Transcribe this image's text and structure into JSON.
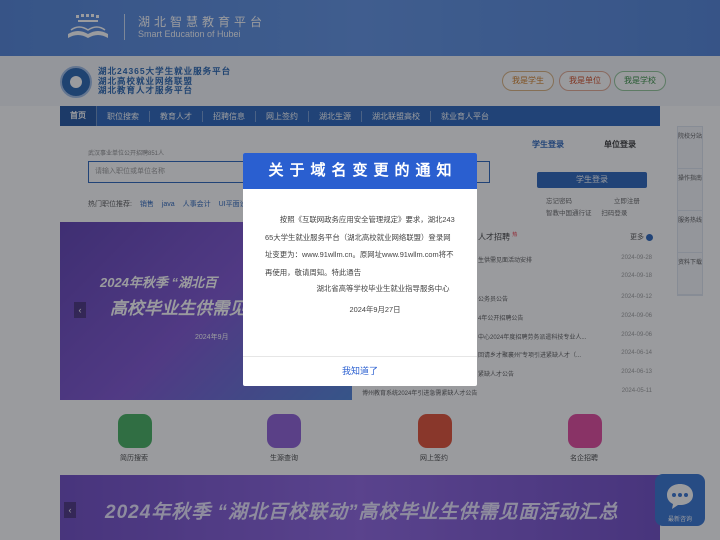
{
  "topbar": {
    "title_cn": "湖北智慧教育平台",
    "title_en": "Smart Education of Hubei"
  },
  "brand": {
    "line1": "湖北24365大学生就业服务平台",
    "line2": "湖北高校就业网络联盟",
    "line3": "湖北教育人才服务平台"
  },
  "role_buttons": [
    "我是学生",
    "我是单位",
    "我是学校"
  ],
  "nav": {
    "items": [
      "首页",
      "职位搜索",
      "教育人才",
      "招聘信息",
      "网上签约",
      "湖北生源",
      "湖北联盟高校",
      "就业育人平台"
    ]
  },
  "search": {
    "hint": "武汉事业单位公开招聘851人",
    "placeholder": "请输入职位或单位名称",
    "hot_label": "热门职位推荐:",
    "hot_items": [
      "销售",
      "java",
      "人事会计",
      "UI平面设计"
    ]
  },
  "login": {
    "tab_student": "学生登录",
    "tab_company": "单位登录",
    "button": "学生登录",
    "forgot": "忘记密码",
    "register": "立即注册",
    "alt1": "智教中国通行证",
    "alt2": "扫码登录"
  },
  "side_float": [
    "院校分站",
    "操作指南",
    "服务热线",
    "资料下载"
  ],
  "banner": {
    "line1": "2024年秋季 “湖北百",
    "line2": "高校毕业生供需见面",
    "line3": "2024年9月"
  },
  "news": {
    "header": "人才招聘",
    "badge": "热",
    "more": "更多",
    "rows": [
      {
        "text": "生供需见面活动安排",
        "date": "2024-09-28"
      },
      {
        "text": "",
        "date": "2024-09-18"
      },
      {
        "text": "公务员公告",
        "date": "2024-09-12"
      },
      {
        "text": "4年公开招聘公告",
        "date": "2024-09-06"
      },
      {
        "text": "中心2024年度招聘劳务派遣科技专业人...",
        "date": "2024-09-06"
      },
      {
        "text": "回请乡才聚襄州”专项引进紧缺人才（...",
        "date": "2024-06-14"
      },
      {
        "text": "紧缺人才公告",
        "date": "2024-06-13"
      },
      {
        "text": "博州教育系统2024年引进急需紧缺人才公告",
        "date": "2024-05-11"
      }
    ]
  },
  "quick_links": [
    "简历搜索",
    "生源查询",
    "网上签约",
    "名企招聘"
  ],
  "banner2": {
    "text": "2024年秋季 “湖北百校联动”高校毕业生供需见面活动汇总"
  },
  "chat": {
    "label": "最新咨询"
  },
  "modal": {
    "title": "关于域名变更的通知",
    "body": "按照《互联网政务应用安全管理规定》要求，湖北24365大学生就业服务平台（湖北高校就业网络联盟）登录网址变更为：www.91wllm.cn。原网址www.91wllm.com将不再使用，敬请周知。特此通告",
    "signature": "湖北省高等学校毕业生就业指导服务中心",
    "date": "2024年9月27日",
    "button": "我知道了"
  },
  "colors": {
    "primary": "#2a5fd0",
    "nav": "#2360b8",
    "overlay": "rgba(30,34,40,.45)"
  }
}
